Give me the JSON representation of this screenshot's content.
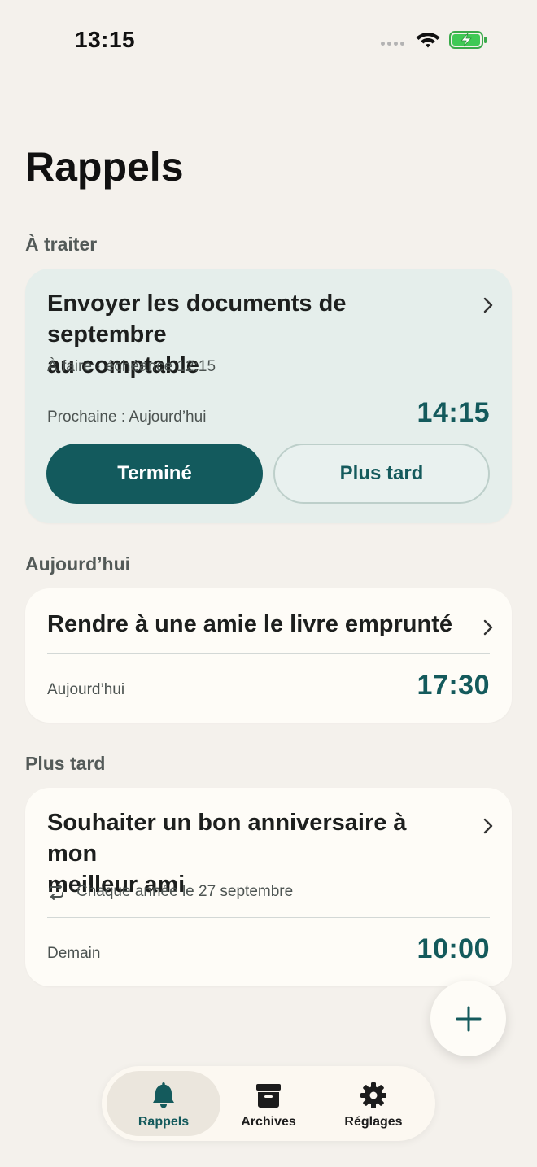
{
  "status_bar": {
    "time": "13:15",
    "icons": [
      "signal-dots",
      "wifi-icon",
      "battery-charging-icon"
    ]
  },
  "page": {
    "title": "Rappels"
  },
  "sections": {
    "todo": {
      "label": "À traiter",
      "card": {
        "title_line1": "Envoyer les documents de septembre",
        "title_line2": "au comptable",
        "status": "À faire · échéance 12:15",
        "next": "Prochaine : Aujourd’hui",
        "time": "14:15",
        "done_label": "Terminé",
        "later_label": "Plus tard"
      }
    },
    "today": {
      "label": "Aujourd’hui",
      "card": {
        "title": "Rendre à une amie le livre emprunté",
        "day": "Aujourd’hui",
        "time": "17:30"
      }
    },
    "later": {
      "label": "Plus tard",
      "card": {
        "title_line1": "Souhaiter un bon anniversaire à mon",
        "title_line2": "meilleur ami",
        "repeat": "Chaque année le 27 septembre",
        "day": "Demain",
        "time": "10:00"
      }
    }
  },
  "fab": {
    "icon": "plus-icon"
  },
  "tab_bar": {
    "tabs": [
      {
        "label": "Rappels",
        "icon": "bell-icon",
        "active": true
      },
      {
        "label": "Archives",
        "icon": "archive-box-icon",
        "active": false
      },
      {
        "label": "Réglages",
        "icon": "gear-icon",
        "active": false
      }
    ]
  },
  "colors": {
    "background": "#f4f1ec",
    "accent": "#145a5c",
    "primary_card": "#e5eeeb",
    "card": "#fefcf7"
  }
}
